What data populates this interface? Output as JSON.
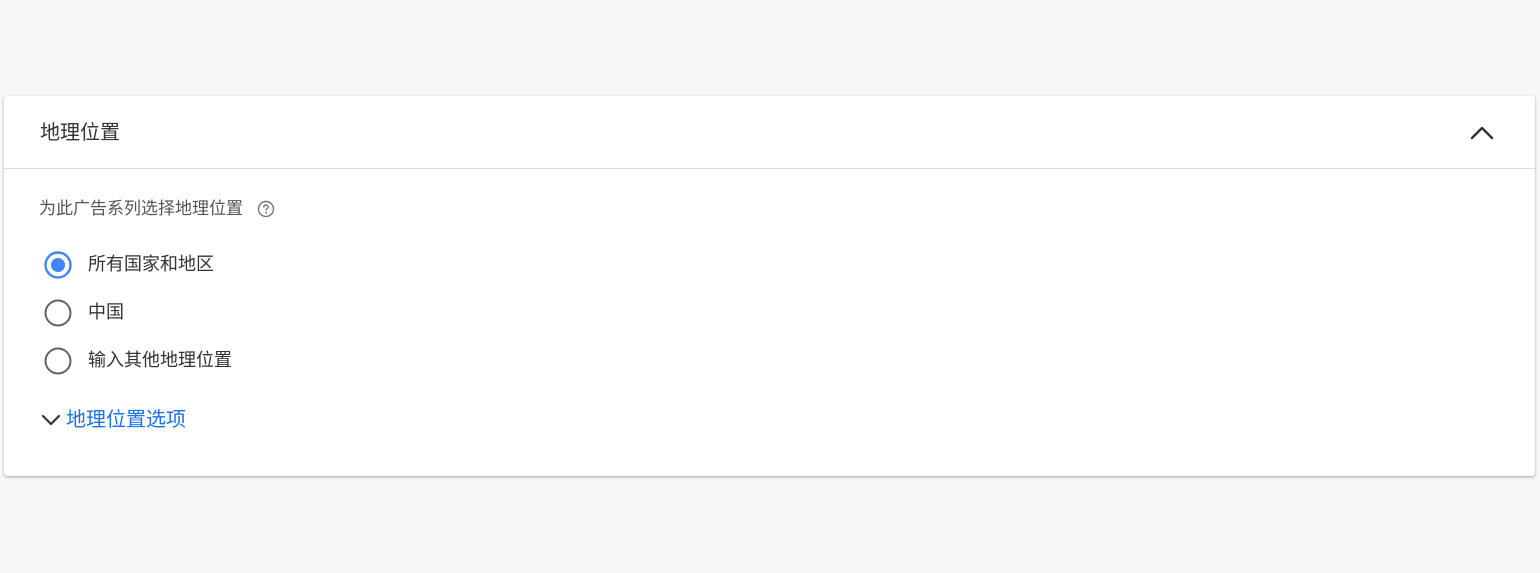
{
  "section": {
    "title": "地理位置",
    "collapse_icon": "chevron-up-icon"
  },
  "question": {
    "label": "为此广告系列选择地理位置",
    "help_icon": "help-circle-icon"
  },
  "radio_options": [
    {
      "label": "所有国家和地区",
      "selected": true
    },
    {
      "label": "中国",
      "selected": false
    },
    {
      "label": "输入其他地理位置",
      "selected": false
    }
  ],
  "options_link": {
    "label": "地理位置选项",
    "icon": "chevron-down-icon"
  },
  "colors": {
    "accent": "#4285f4",
    "link": "#1a73e8",
    "background": "#f7f7f7"
  }
}
